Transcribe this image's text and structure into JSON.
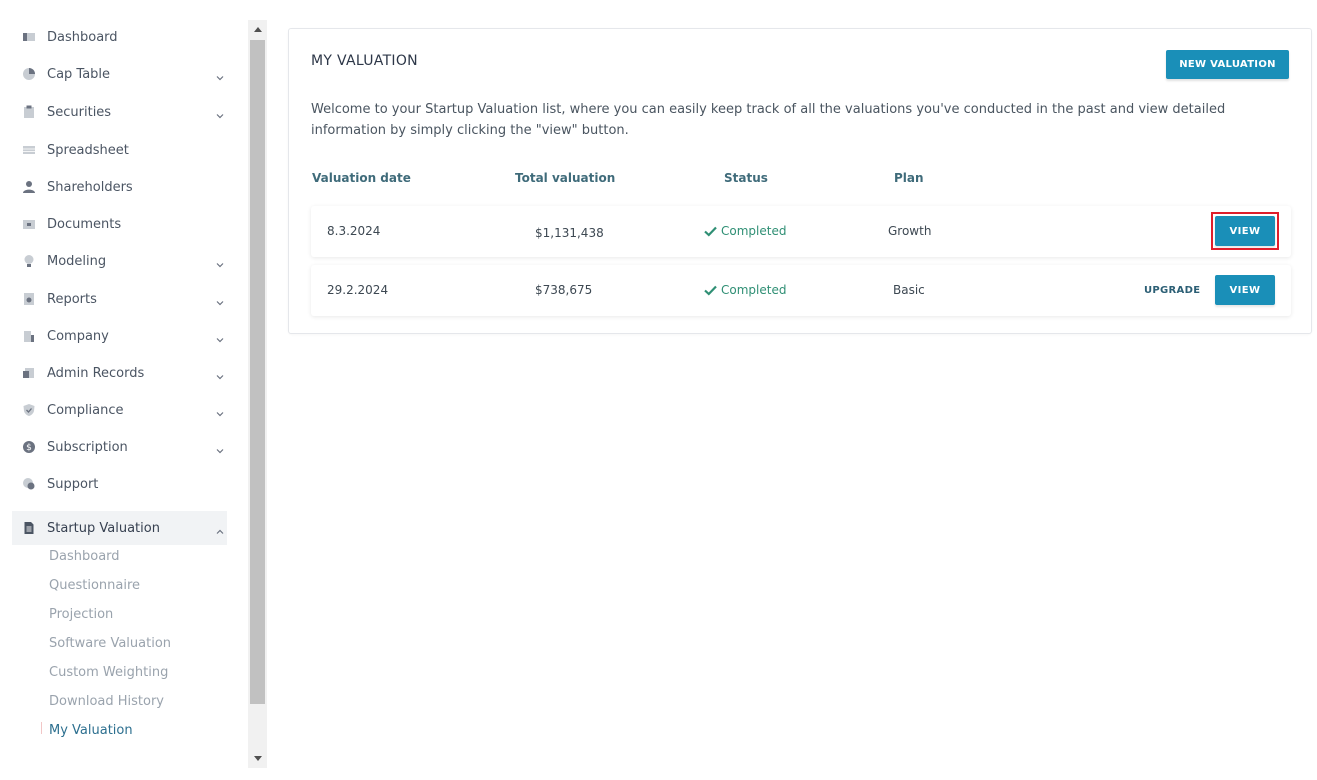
{
  "sidebar": {
    "items": [
      {
        "label": "Dashboard",
        "icon": "dashboard-icon",
        "expandable": false
      },
      {
        "label": "Cap Table",
        "icon": "pie-chart-icon",
        "expandable": true
      },
      {
        "label": "Securities",
        "icon": "clipboard-icon",
        "expandable": true
      },
      {
        "label": "Spreadsheet",
        "icon": "spreadsheet-icon",
        "expandable": false
      },
      {
        "label": "Shareholders",
        "icon": "person-icon",
        "expandable": false
      },
      {
        "label": "Documents",
        "icon": "folder-icon",
        "expandable": false
      },
      {
        "label": "Modeling",
        "icon": "lightbulb-icon",
        "expandable": true
      },
      {
        "label": "Reports",
        "icon": "report-icon",
        "expandable": true
      },
      {
        "label": "Company",
        "icon": "building-icon",
        "expandable": true
      },
      {
        "label": "Admin Records",
        "icon": "records-icon",
        "expandable": true
      },
      {
        "label": "Compliance",
        "icon": "shield-icon",
        "expandable": true
      },
      {
        "label": "Subscription",
        "icon": "dollar-icon",
        "expandable": true
      },
      {
        "label": "Support",
        "icon": "support-icon",
        "expandable": false
      }
    ],
    "active_section": {
      "label": "Startup Valuation",
      "icon": "document-icon"
    },
    "sub_items": [
      {
        "label": "Dashboard"
      },
      {
        "label": "Questionnaire"
      },
      {
        "label": "Projection"
      },
      {
        "label": "Software Valuation"
      },
      {
        "label": "Custom Weighting"
      },
      {
        "label": "Download History"
      },
      {
        "label": "My Valuation"
      }
    ]
  },
  "main": {
    "title": "MY VALUATION",
    "new_button": "NEW VALUATION",
    "intro": "Welcome to your Startup Valuation list, where you can easily keep track of all the valuations you've conducted in the past and view detailed information by simply clicking the \"view\" button.",
    "columns": [
      "Valuation date",
      "Total valuation",
      "Status",
      "Plan"
    ],
    "rows": [
      {
        "date": "8.3.2024",
        "total": "$1,131,438",
        "status": "Completed",
        "plan": "Growth",
        "view": "VIEW",
        "upgrade": ""
      },
      {
        "date": "29.2.2024",
        "total": "$738,675",
        "status": "Completed",
        "plan": "Basic",
        "view": "VIEW",
        "upgrade": "UPGRADE"
      }
    ]
  },
  "colors": {
    "accent": "#1a8fb8",
    "status_green": "#2f8f74",
    "highlight": "#e01e2b"
  }
}
